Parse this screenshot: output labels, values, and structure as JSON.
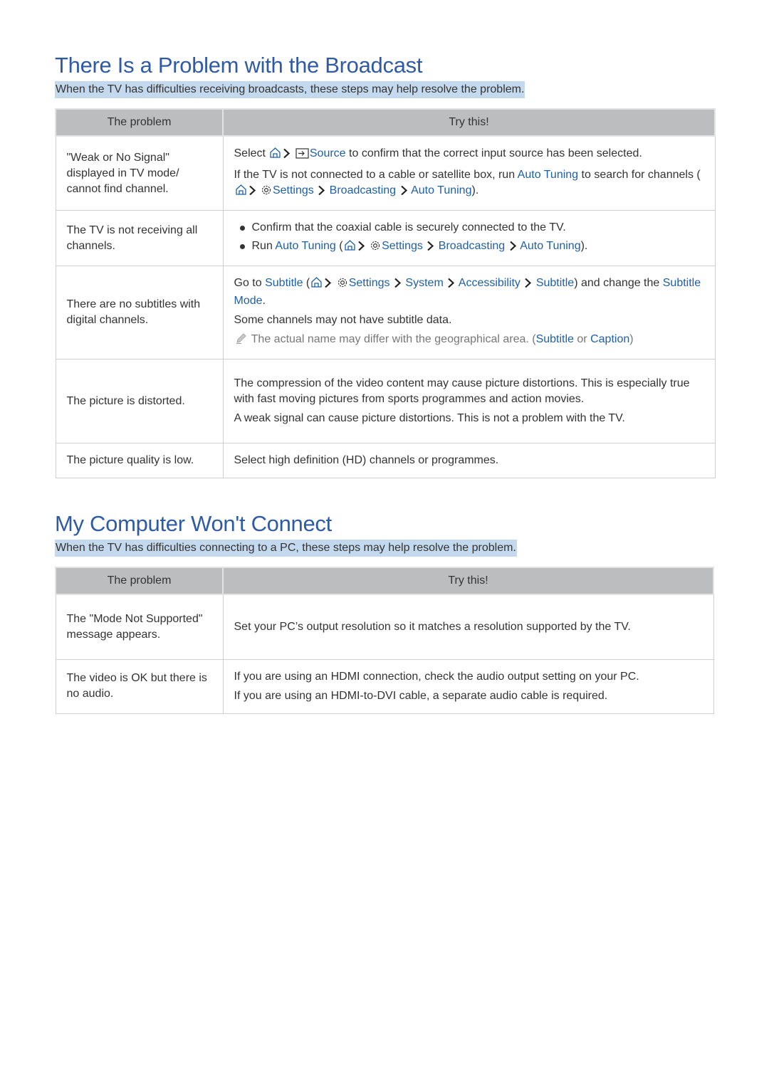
{
  "colors": {
    "heading": "#2f5aa4",
    "link": "#1e5fa8",
    "highlight": "#c5d9ee",
    "header_bg": "#bcbdbf",
    "note": "#777777"
  },
  "section1": {
    "title": "There Is a Problem with the Broadcast",
    "intro": "When the TV has difficulties receiving broadcasts, these steps may help resolve the problem.",
    "headers": {
      "problem": "The problem",
      "try": "Try this!"
    },
    "rows": [
      {
        "problem": "\"Weak or No Signal\" displayed in TV mode/ cannot find channel.",
        "r0": {
          "t0": "Select",
          "t1": "Source",
          "t2": "to confirm that the correct input source has been selected."
        },
        "r1": {
          "t0": "If the TV is not connected to a cable or satellite box, run",
          "t1": "Auto Tuning",
          "t2": "to search for channels (",
          "t3": "Settings",
          "t4": "Broadcasting",
          "t5": "Auto Tuning",
          "t6": ")."
        }
      },
      {
        "problem": "The TV is not receiving all channels.",
        "b0": "Confirm that the coaxial cable is securely connected to the TV.",
        "b1": {
          "t0": "Run",
          "t1": "Auto Tuning",
          "t2": "(",
          "t3": "Settings",
          "t4": "Broadcasting",
          "t5": "Auto Tuning",
          "t6": ")."
        }
      },
      {
        "problem": "There are no subtitles with digital channels.",
        "r0": {
          "t0": "Go to",
          "t1": "Subtitle",
          "t2": "(",
          "t3": "Settings",
          "t4": "System",
          "t5": "Accessibility",
          "t6": "Subtitle",
          "t7": ") and change the",
          "t8": "Subtitle Mode",
          "t9": "."
        },
        "r1": "Some channels may not have subtitle data.",
        "note": {
          "t0": "The actual name may differ with the geographical area. (",
          "t1": "Subtitle",
          "t2": "or",
          "t3": "Caption",
          "t4": ")"
        }
      },
      {
        "problem": "The picture is distorted.",
        "r0": "The compression of the video content may cause picture distortions. This is especially true with fast moving pictures from sports programmes and action movies.",
        "r1": "A weak signal can cause picture distortions. This is not a problem with the TV."
      },
      {
        "problem": "The picture quality is low.",
        "r0": "Select high definition (HD) channels or programmes."
      }
    ]
  },
  "section2": {
    "title": "My Computer Won't Connect",
    "intro": "When the TV has difficulties connecting to a PC, these steps may help resolve the problem.",
    "headers": {
      "problem": "The problem",
      "try": "Try this!"
    },
    "rows": [
      {
        "problem": "The \"Mode Not Supported\" message appears.",
        "r0": "Set your PC’s output resolution so it matches a resolution supported by the TV."
      },
      {
        "problem": "The video is OK but there is no audio.",
        "r0": "If you are using an HDMI connection, check the audio output setting on your PC.",
        "r1": "If you are using an HDMI-to-DVI cable, a separate audio cable is required."
      }
    ]
  },
  "icons": {
    "home": "home-icon",
    "chevron": "chevron-right-icon",
    "source": "source-icon",
    "settings": "gear-icon",
    "note": "pencil-note-icon"
  }
}
